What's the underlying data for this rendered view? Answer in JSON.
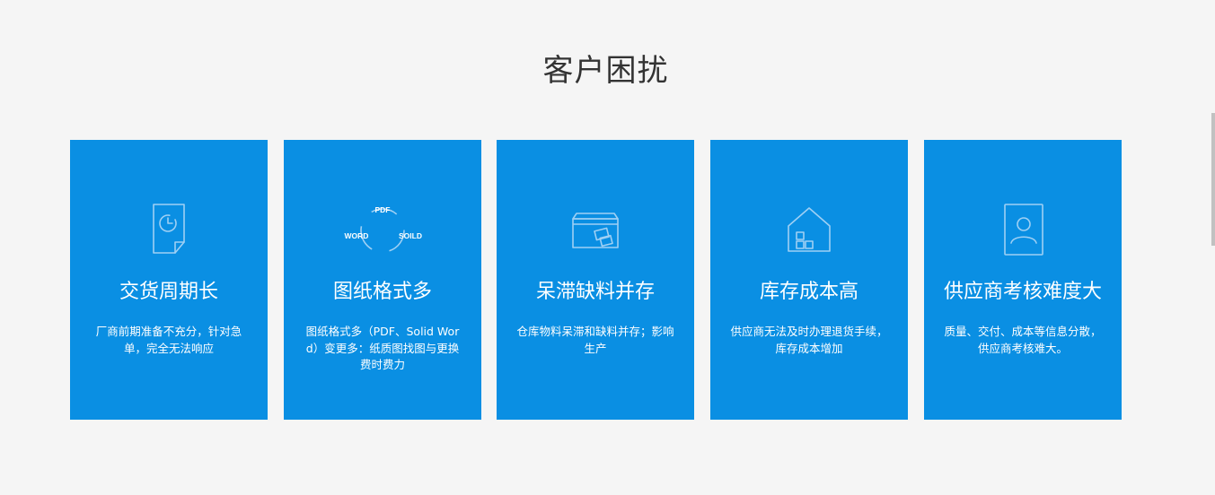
{
  "section": {
    "title": "客户困扰"
  },
  "cards": [
    {
      "icon": "clock-document-icon",
      "title": "交货周期长",
      "desc": "厂商前期准备不充分，针对急单，完全无法响应"
    },
    {
      "icon": "format-cycle-icon",
      "icon_labels": {
        "top": "PDF",
        "left": "WORD",
        "right": "SOILD"
      },
      "title": "图纸格式多",
      "desc": "图纸格式多（PDF、Solid Word）变更多：纸质图找图与更换费时费力"
    },
    {
      "icon": "inventory-box-icon",
      "title": "呆滞缺料并存",
      "desc": "仓库物料呆滞和缺料并存；影响生产"
    },
    {
      "icon": "warehouse-house-icon",
      "title": "库存成本高",
      "desc": "供应商无法及时办理退货手续，库存成本增加"
    },
    {
      "icon": "supplier-profile-icon",
      "title": "供应商考核难度大",
      "desc": "质量、交付、成本等信息分散，供应商考核难大。"
    }
  ],
  "colors": {
    "page_background": "#f5f5f5",
    "card_background": "#0a8fe3",
    "title_text": "#333333",
    "card_text": "#ffffff",
    "icon_stroke": "#9fd0f4"
  }
}
